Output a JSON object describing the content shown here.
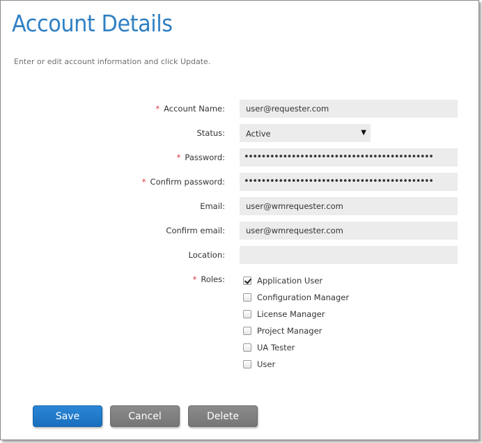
{
  "page": {
    "title": "Account Details",
    "intro": "Enter or edit account information and click Update."
  },
  "form": {
    "account_name": {
      "label": "Account Name:",
      "required": true,
      "value": "user@requester.com"
    },
    "status": {
      "label": "Status:",
      "required": false,
      "value": "Active"
    },
    "password": {
      "label": "Password:",
      "required": true,
      "value": "••••••••••••••••••••••••••••••••••••••••••••"
    },
    "confirm_password": {
      "label": "Confirm password:",
      "required": true,
      "value": "••••••••••••••••••••••••••••••••••••••••••••"
    },
    "email": {
      "label": "Email:",
      "required": false,
      "value": "user@wmrequester.com"
    },
    "confirm_email": {
      "label": "Confirm email:",
      "required": false,
      "value": "user@wmrequester.com"
    },
    "location": {
      "label": "Location:",
      "required": false,
      "value": ""
    },
    "roles": {
      "label": "Roles:",
      "required": true,
      "items": [
        {
          "label": "Application User",
          "checked": true
        },
        {
          "label": "Configuration Manager",
          "checked": false
        },
        {
          "label": "License Manager",
          "checked": false
        },
        {
          "label": "Project Manager",
          "checked": false
        },
        {
          "label": "UA Tester",
          "checked": false
        },
        {
          "label": "User",
          "checked": false
        }
      ]
    }
  },
  "required_marker": "*",
  "buttons": {
    "save": "Save",
    "cancel": "Cancel",
    "delete": "Delete"
  },
  "colors": {
    "title": "#2f80c4",
    "required": "#d9363e",
    "primary_button": "#1f78c9",
    "secondary_button": "#7d7d7d",
    "field_background": "#ececec"
  }
}
